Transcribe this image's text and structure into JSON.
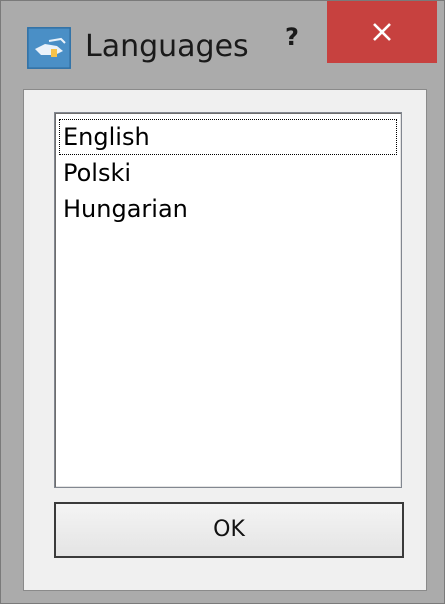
{
  "window": {
    "title": "Languages",
    "help_label": "?",
    "icons": {
      "app": "app-icon",
      "close": "close-icon"
    },
    "colors": {
      "close_button": "#c7413f",
      "frame": "#ababab"
    }
  },
  "listbox": {
    "items": [
      {
        "label": "English"
      },
      {
        "label": "Polski"
      },
      {
        "label": "Hungarian"
      }
    ]
  },
  "buttons": {
    "ok_label": "OK"
  }
}
